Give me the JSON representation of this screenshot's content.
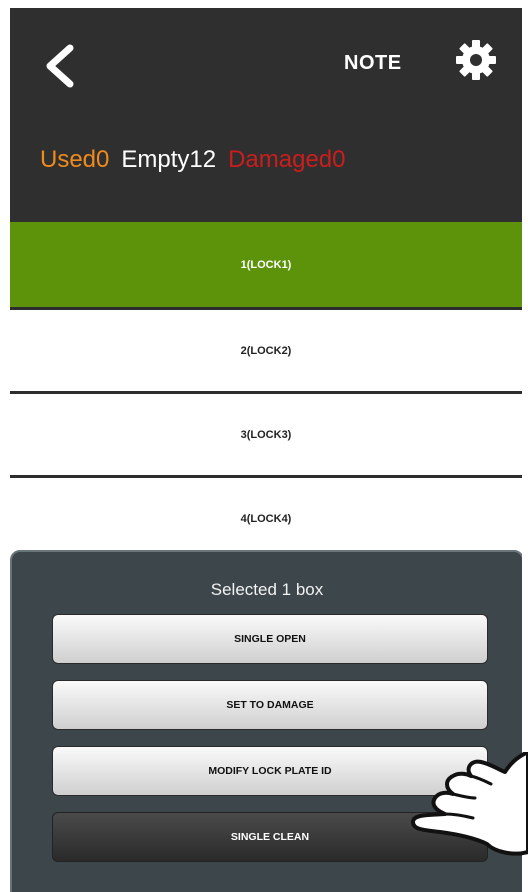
{
  "header": {
    "note_label": "NOTE",
    "back_icon": "chevron-left-icon",
    "settings_icon": "gear-icon"
  },
  "stats": {
    "used": "Used0",
    "empty": "Empty12",
    "damaged": "Damaged0"
  },
  "locks": [
    {
      "label": "1(LOCK1)",
      "selected": true
    },
    {
      "label": "2(LOCK2)",
      "selected": false
    },
    {
      "label": "3(LOCK3)",
      "selected": false
    },
    {
      "label": "4(LOCK4)",
      "selected": false
    }
  ],
  "sheet": {
    "title": "Selected 1 box",
    "actions": [
      {
        "label": "SINGLE OPEN"
      },
      {
        "label": "SET TO DAMAGE"
      },
      {
        "label": "MODIFY LOCK PLATE ID"
      },
      {
        "label": "SINGLE CLEAN"
      }
    ]
  },
  "colors": {
    "selected_row": "#5c930a",
    "used": "#ef8a1c",
    "damaged": "#cc1d1d",
    "sheet_bg": "#3d464a"
  }
}
